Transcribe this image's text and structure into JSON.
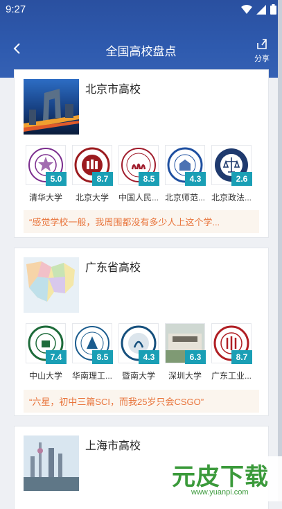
{
  "status_bar": {
    "time": "9:27"
  },
  "header": {
    "title": "全国高校盘点",
    "share_label": "分享"
  },
  "colors": {
    "header": "#2e5aae",
    "score_badge": "#1a9fb5",
    "quote_text": "#e8733a",
    "watermark": "#3b9a3b"
  },
  "cards": [
    {
      "title": "北京市高校",
      "schools": [
        {
          "name": "清华大学",
          "score": "5.0"
        },
        {
          "name": "北京大学",
          "score": "8.7"
        },
        {
          "name": "中国人民...",
          "score": "8.5"
        },
        {
          "name": "北京师范...",
          "score": "4.3"
        },
        {
          "name": "北京政法...",
          "score": "2.6"
        }
      ],
      "quote": "“感觉学校一般，我周围都没有多少人上这个学..."
    },
    {
      "title": "广东省高校",
      "schools": [
        {
          "name": "中山大学",
          "score": "7.4"
        },
        {
          "name": "华南理工...",
          "score": "8.5"
        },
        {
          "name": "暨南大学",
          "score": "4.3"
        },
        {
          "name": "深圳大学",
          "score": "6.3"
        },
        {
          "name": "广东工业...",
          "score": "8.7"
        }
      ],
      "quote": "“六星，初中三篇SCI，而我25岁只会CSGO”"
    },
    {
      "title": "上海市高校"
    }
  ],
  "watermark": {
    "text": "元皮下载",
    "url": "www.yuanpi.com"
  }
}
